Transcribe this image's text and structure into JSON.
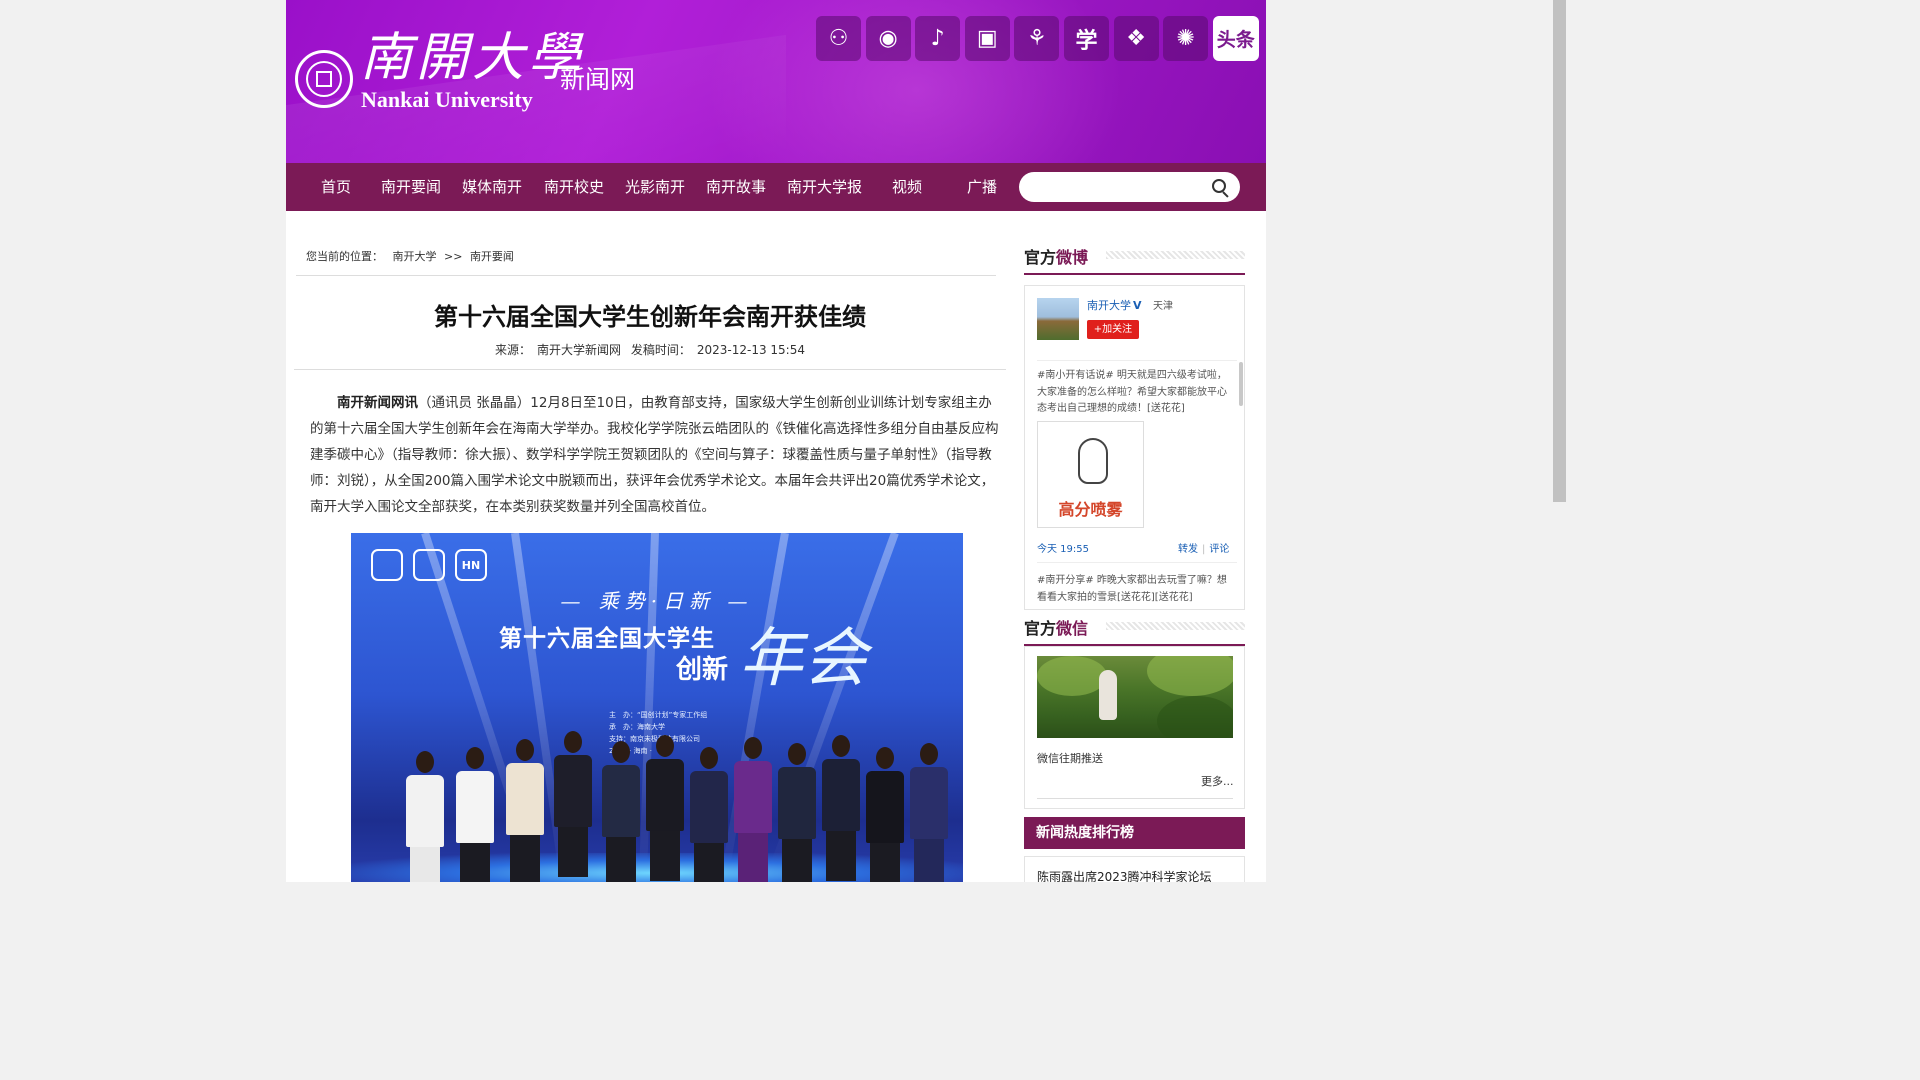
{
  "header": {
    "logo_cn": "南開大學",
    "logo_en": "Nankai University",
    "site_name": "新闻网",
    "social_icons": [
      {
        "name": "wechat-icon",
        "glyph": "⚇"
      },
      {
        "name": "weibo-icon",
        "glyph": "◉"
      },
      {
        "name": "douyin-icon",
        "glyph": "♪"
      },
      {
        "name": "bilibili-icon",
        "glyph": "▣"
      },
      {
        "name": "kuaishou-icon",
        "glyph": "⚘"
      },
      {
        "name": "xuexi-icon",
        "glyph": "学"
      },
      {
        "name": "dots-icon",
        "glyph": "❖"
      },
      {
        "name": "dandelion-icon",
        "glyph": "✺"
      },
      {
        "name": "toutiao-icon",
        "glyph": "头条"
      }
    ]
  },
  "nav": {
    "items": [
      "首页",
      "南开要闻",
      "媒体南开",
      "南开校史",
      "光影南开",
      "南开故事",
      "南开大学报",
      "视频",
      "广播"
    ],
    "search_placeholder": ""
  },
  "breadcrumb": {
    "prefix": "您当前的位置：",
    "home": "南开大学",
    "sep": ">>",
    "current": "南开要闻"
  },
  "article": {
    "title": "第十六届全国大学生创新年会南开获佳绩",
    "source_label": "来源：",
    "source": "南开大学新闻网",
    "date_label": "发稿时间：",
    "date": "2023-12-13 15:54",
    "lead": "南开新闻网讯",
    "body": "（通讯员 张晶晶）12月8日至10日，由教育部支持，国家级大学生创新创业训练计划专家组主办的第十六届全国大学生创新年会在海南大学举办。我校化学学院张云皓团队的《铁催化高选择性多组分自由基反应构建季碳中心》（指导教师：徐大振）、数学科学学院王贺颖团队的《空间与算子：球覆盖性质与量子单射性》（指导教师：刘锐），从全国200篇入围学术论文中脱颖而出，获评年会优秀学术论文。本届年会共评出20篇优秀学术论文，南开大学入围论文全部获奖，在本类别获奖数量并列全国高校首位。",
    "photo": {
      "emblem1": "",
      "emblem2": "",
      "emblem3": "HN",
      "slogan": "— 乘势·日新 —",
      "headline1": "第十六届全国大学生",
      "headline2": "创新",
      "headline3": "年会",
      "credit1": "主　办：“国创计划”专家工作组",
      "credit2": "承　办：海南大学",
      "credit3": "支持：南京未极科技有限公司",
      "credit4": "2023 · 海南 ·"
    }
  },
  "sidebar": {
    "weibo": {
      "title_a": "官方",
      "title_b": "微博",
      "account": "南开大学",
      "verified": "V",
      "location": "天津",
      "follow": "+加关注",
      "post1": "#南小开有话说# 明天就是四六级考试啦，大家准备的怎么样啦？希望大家都能放平心态考出自己理想的成绩！[送花花]",
      "post1_image_caption": "高分喷雾",
      "post1_time": "今天 19:55",
      "repost": "转发",
      "divider": "|",
      "comment": "评论",
      "post2": "#南开分享# 昨晚大家都出去玩雪了嘛？想看看大家拍的雪景[送花花][送花花]"
    },
    "wechat": {
      "title_a": "官方",
      "title_b": "微信",
      "label": "微信往期推送",
      "more": "更多..."
    },
    "ranking": {
      "title": "新闻热度排行榜",
      "first_item": "陈雨露出席2023腾冲科学家论坛"
    }
  },
  "colors": {
    "brand_purple": "#7b1a56",
    "banner_purple": "#a318cc",
    "link_blue": "#1a5fb4",
    "follow_red": "#e0201c"
  }
}
